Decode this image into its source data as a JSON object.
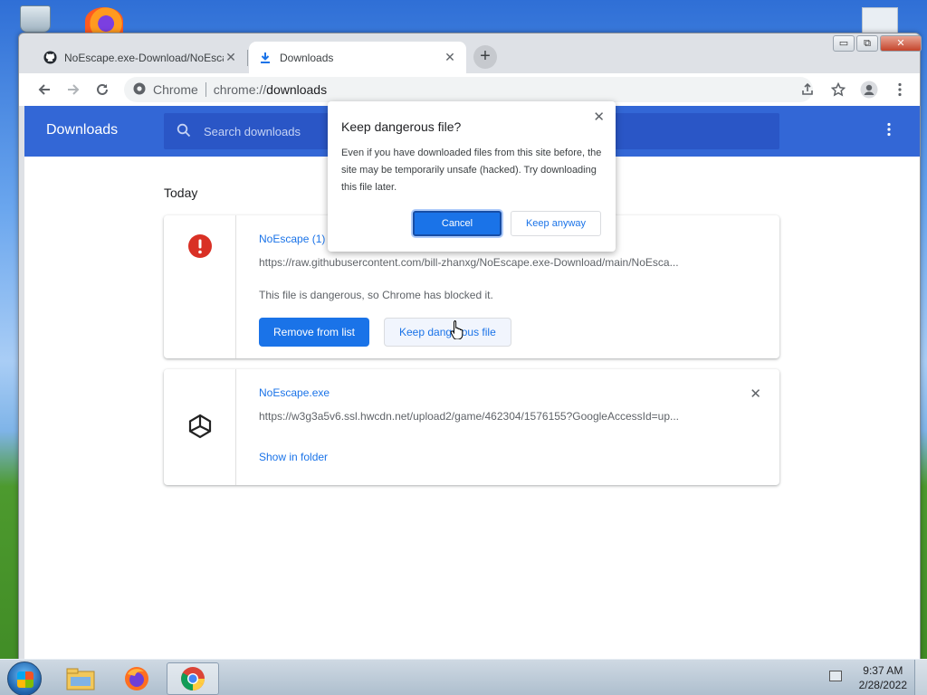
{
  "browser": {
    "tabs": [
      {
        "title": "NoEscape.exe-Download/NoEscape",
        "icon": "github-icon",
        "active": false
      },
      {
        "title": "Downloads",
        "icon": "download-icon",
        "active": true
      }
    ],
    "newtab_label": "+",
    "window_controls": {
      "minimize": "▭",
      "maximize": "⧉",
      "close": "✕"
    },
    "omnibox": {
      "site": "Chrome",
      "url_prefix": "chrome://",
      "url_path": "downloads"
    }
  },
  "downloads_page": {
    "title": "Downloads",
    "search_placeholder": "Search downloads",
    "section_label": "Today",
    "items": [
      {
        "name": "NoEscape (1)",
        "url": "https://raw.githubusercontent.com/bill-zhanxg/NoEscape.exe-Download/main/NoEsca...",
        "status": "This file is dangerous, so Chrome has blocked it.",
        "remove_button": "Remove from list",
        "keep_button": "Keep dangerous file",
        "icon": "danger-icon"
      },
      {
        "name": "NoEscape.exe",
        "url": "https://w3g3a5v6.ssl.hwcdn.net/upload2/game/462304/1576155?GoogleAccessId=up...",
        "action": "Show in folder",
        "icon": "unity-icon"
      }
    ]
  },
  "dialog": {
    "title": "Keep dangerous file?",
    "body": "Even if you have downloaded files from this site before, the site may be temporarily unsafe (hacked). Try downloading this file later.",
    "cancel": "Cancel",
    "keep": "Keep anyway",
    "close": "✕"
  },
  "taskbar": {
    "time": "9:37 AM",
    "date": "2/28/2022",
    "apps": [
      "file-explorer-icon",
      "firefox-icon",
      "chrome-icon"
    ]
  },
  "colors": {
    "accent": "#1a73e8",
    "header": "#3367d6",
    "danger": "#d93025"
  }
}
